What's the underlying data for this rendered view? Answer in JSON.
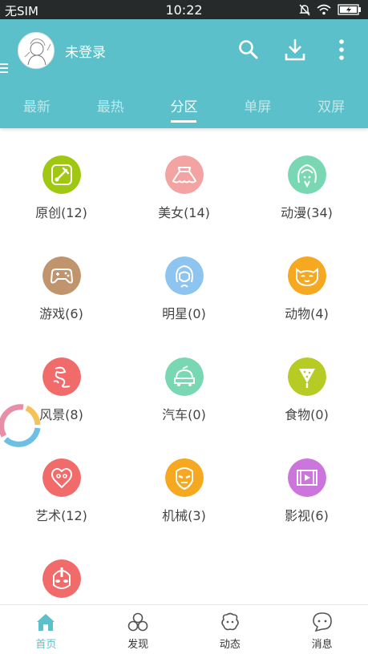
{
  "status_bar": {
    "carrier": "无SIM",
    "time": "10:22"
  },
  "header": {
    "login_text": "未登录",
    "icons": {
      "menu": "menu-icon",
      "search": "search-icon",
      "download": "download-icon",
      "more": "more-icon"
    }
  },
  "tabs": [
    {
      "label": "最新"
    },
    {
      "label": "最热"
    },
    {
      "label": "分区"
    },
    {
      "label": "单屏"
    },
    {
      "label": "双屏"
    }
  ],
  "active_tab": "分区",
  "categories": [
    {
      "label": "原创(12)",
      "icon": "brush-icon",
      "color": "#a0c712"
    },
    {
      "label": "美女(14)",
      "icon": "skirt-icon",
      "color": "#f4a3a3"
    },
    {
      "label": "动漫(34)",
      "icon": "anime-girl-icon",
      "color": "#7ad7b4"
    },
    {
      "label": "游戏(6)",
      "icon": "gamepad-icon",
      "color": "#c0956e"
    },
    {
      "label": "明星(0)",
      "icon": "star-person-icon",
      "color": "#8ec5f0"
    },
    {
      "label": "动物(4)",
      "icon": "cat-icon",
      "color": "#f6a820"
    },
    {
      "label": "风景(8)",
      "icon": "dragon-icon",
      "color": "#f16b6b"
    },
    {
      "label": "汽车(0)",
      "icon": "car-icon",
      "color": "#7ad7b4"
    },
    {
      "label": "食物(0)",
      "icon": "ice-cream-icon",
      "color": "#b6cc24"
    },
    {
      "label": "艺术(12)",
      "icon": "mask-icon",
      "color": "#f16b6b"
    },
    {
      "label": "机械(3)",
      "icon": "robot-icon",
      "color": "#f6a820"
    },
    {
      "label": "影视(6)",
      "icon": "film-icon",
      "color": "#cc75dc"
    },
    {
      "label": "",
      "icon": "ultraman-icon",
      "color": "#f16b6b"
    }
  ],
  "bottom_nav": [
    {
      "label": "首页",
      "icon": "home-icon",
      "active": true
    },
    {
      "label": "发现",
      "icon": "discover-icon",
      "active": false
    },
    {
      "label": "动态",
      "icon": "feed-icon",
      "active": false
    },
    {
      "label": "消息",
      "icon": "message-icon",
      "active": false
    }
  ],
  "colors": {
    "primary": "#5bc0c9",
    "status_bar": "#272a2a",
    "text": "#444444"
  }
}
